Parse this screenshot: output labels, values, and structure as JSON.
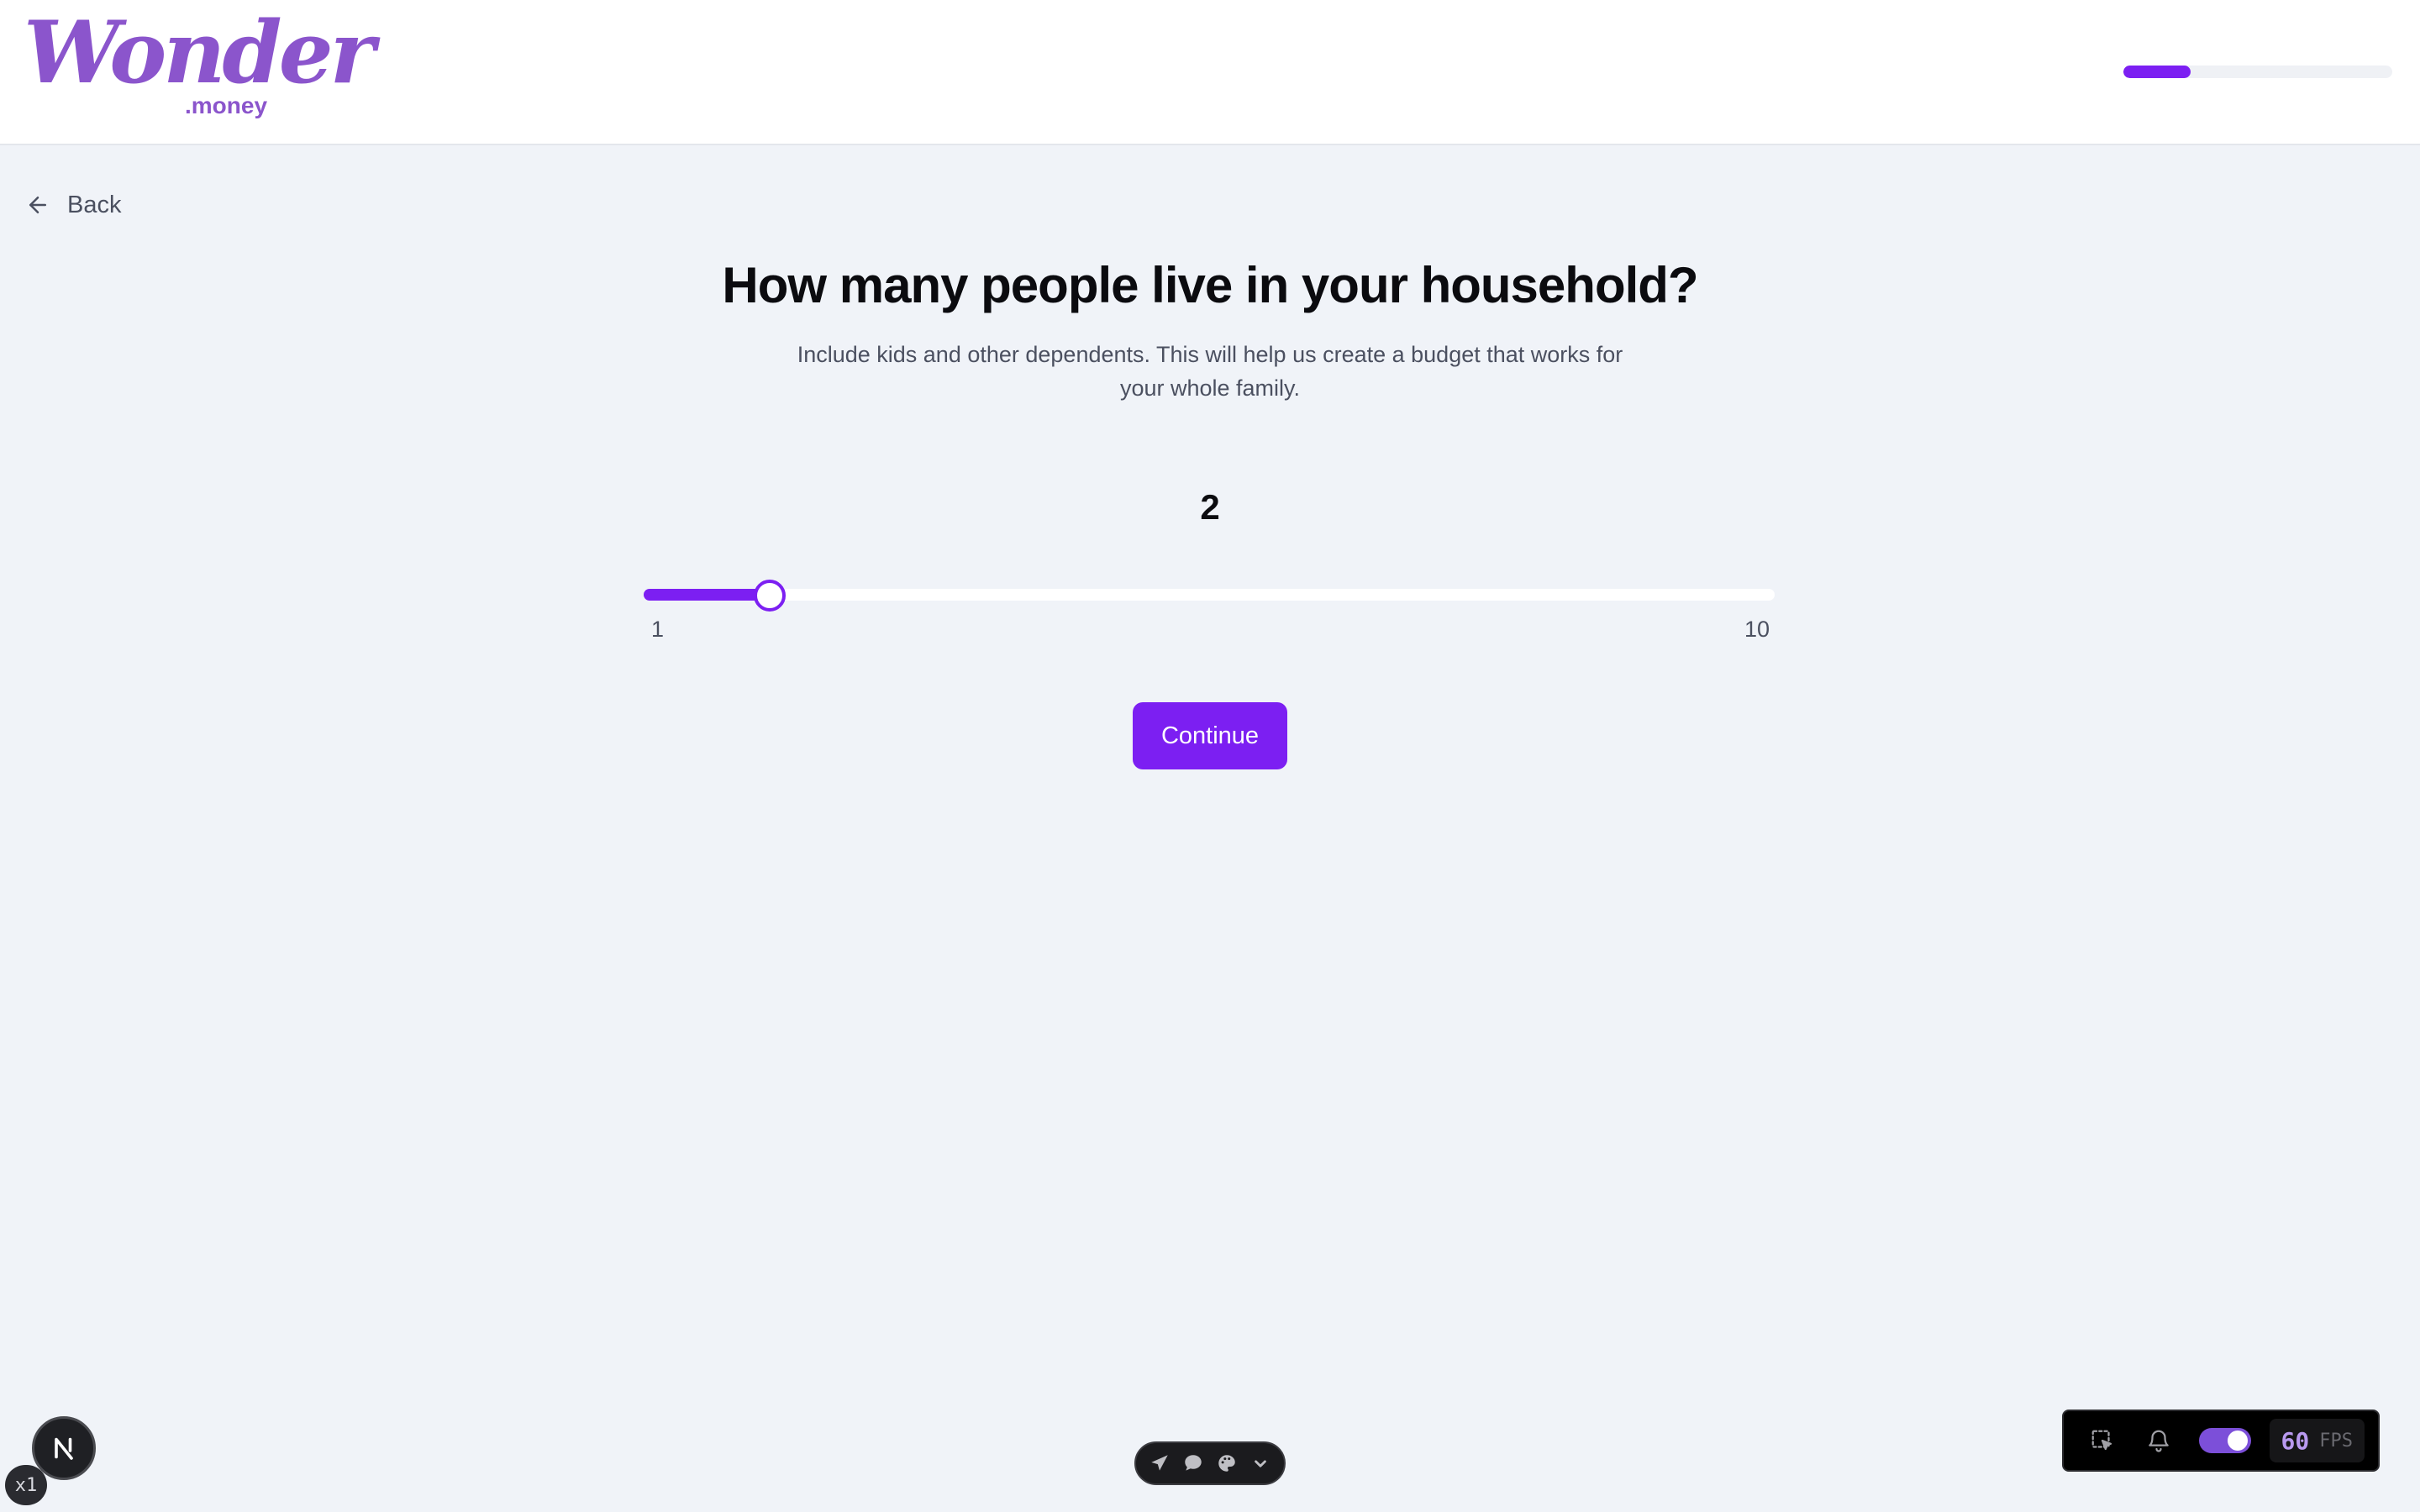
{
  "brand": {
    "name": "Wonder",
    "suffix": ".money",
    "color": "#8b55cc"
  },
  "onboarding": {
    "progress_fraction": 0.25
  },
  "nav": {
    "back_label": "Back"
  },
  "question": {
    "title": "How many people live in your household?",
    "subtitle": "Include kids and other dependents. This will help us create a budget that works for your whole family."
  },
  "slider": {
    "value": 2,
    "min": 1,
    "max": 10,
    "min_label": "1",
    "max_label": "10",
    "accent": "#7c1ff2"
  },
  "actions": {
    "continue_label": "Continue"
  },
  "devtools": {
    "next_badge_letter": "N",
    "zoom_label": "x1",
    "center_toolbar_icons": [
      "send-icon",
      "comment-icon",
      "palette-icon",
      "chevron-down-icon"
    ],
    "right_toolbar_icons": [
      "select-element-icon",
      "bell-icon"
    ],
    "toggle_on": true,
    "fps_value": "60",
    "fps_label": "FPS"
  }
}
